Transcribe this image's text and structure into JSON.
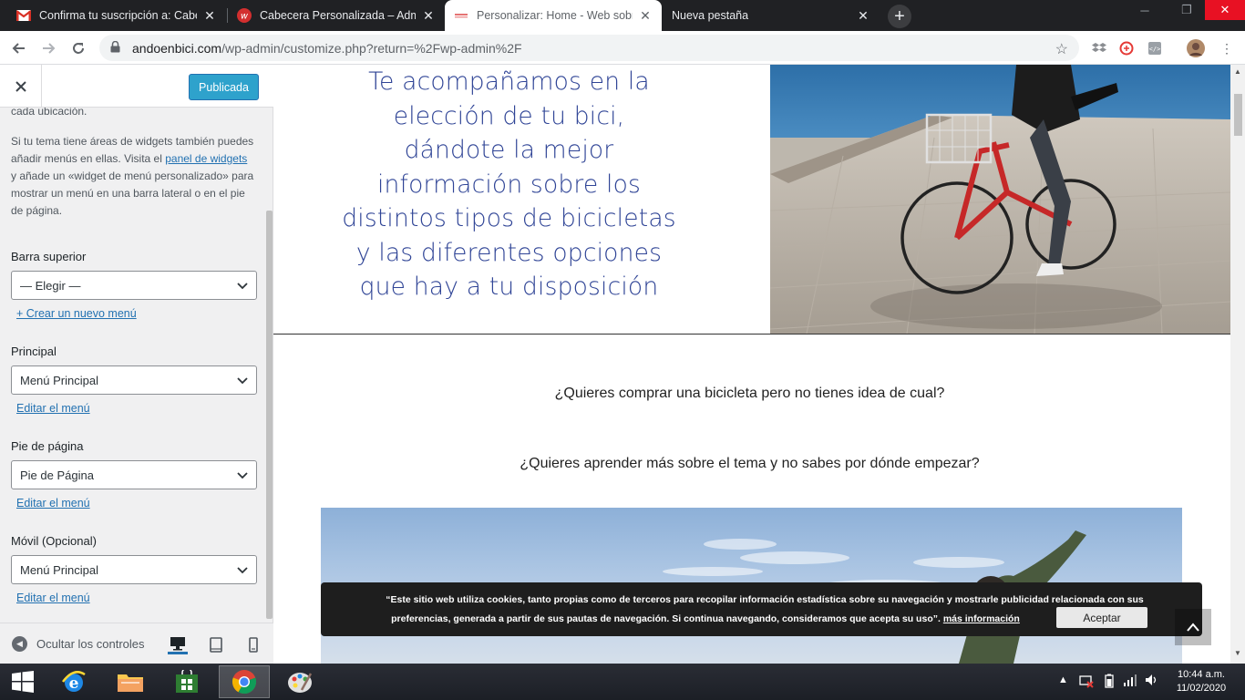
{
  "browser": {
    "tabs": [
      {
        "title": "Confirma tu suscripción a: Cabec",
        "icon": "gmail-icon",
        "active": false
      },
      {
        "title": "Cabecera Personalizada – Admin",
        "icon": "site-favicon",
        "active": false
      },
      {
        "title": "Personalizar: Home - Web sobre",
        "icon": "page-favicon",
        "active": true
      },
      {
        "title": "Nueva pestaña",
        "icon": "",
        "active": false
      }
    ],
    "url_domain": "andoenbici.com",
    "url_path": "/wp-admin/customize.php?return=%2Fwp-admin%2F"
  },
  "customizer": {
    "publish_label": "Publicada",
    "intro_top": "cada ubicación.",
    "intro_p1": "Si tu tema tiene áreas de widgets también puedes añadir menús en ellas. Visita el ",
    "intro_link": "panel de widgets",
    "intro_p2": " y añade un «widget de menú personalizado» para mostrar un menú en una barra lateral o en el pie de página.",
    "locations": [
      {
        "label": "Barra superior",
        "selected": "— Elegir —",
        "link": "+ Crear un nuevo menú"
      },
      {
        "label": "Principal",
        "selected": "Menú Principal",
        "link": "Editar el menú"
      },
      {
        "label": "Pie de página",
        "selected": "Pie de Página",
        "link": "Editar el menú"
      },
      {
        "label": "Móvil (Opcional)",
        "selected": "Menú Principal",
        "link": "Editar el menú"
      }
    ],
    "hide_controls_label": "Ocultar los controles"
  },
  "preview": {
    "hero_lines": [
      "Te acompañamos en la",
      "elección de tu bici,",
      "dándote la mejor",
      "información sobre los",
      "distintos tipos de bicicletas",
      "y las diferentes opciones",
      "que  hay a tu disposición"
    ],
    "question1": "¿Quieres comprar una bicicleta pero no tienes idea de cual?",
    "question2": "¿Quieres aprender más sobre el tema y no sabes por dónde empezar?",
    "cookie_text_line1": "“Este sitio web utiliza cookies, tanto propias como de terceros para recopilar información estadística sobre su navegación y mostrarle publicidad relacionada con sus",
    "cookie_text_line2": "preferencias, generada a partir de sus pautas de navegación. Si continua navegando, consideramos que acepta su uso”.",
    "cookie_more": "más información",
    "cookie_accept": "Aceptar",
    "title_color": "#2f4496"
  },
  "taskbar": {
    "time": "10:44 a.m.",
    "date": "11/02/2020"
  }
}
